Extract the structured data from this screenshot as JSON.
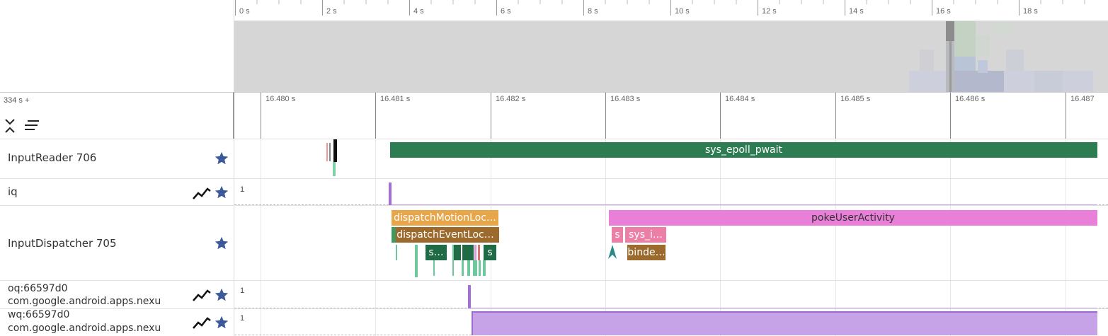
{
  "overview": {
    "ticks": [
      "0 s",
      "2 s",
      "4 s",
      "6 s",
      "8 s",
      "10 s",
      "12 s",
      "14 s",
      "16 s",
      "18 s"
    ]
  },
  "detail": {
    "offset_label": "334 s +",
    "ticks": [
      "16.480 s",
      "16.481 s",
      "16.482 s",
      "16.483 s",
      "16.484 s",
      "16.485 s",
      "16.486 s",
      "16.487"
    ]
  },
  "tracks": {
    "input_reader": {
      "name": "InputReader 706",
      "slice": "sys_epoll_pwait"
    },
    "iq": {
      "name": "iq",
      "scale": "1"
    },
    "input_dispatcher": {
      "name": "InputDispatcher 705",
      "slices": {
        "dispatch_motion": "dispatchMotionLoc…",
        "dispatch_event": "dispatchEventLoc…",
        "s_small": "s…",
        "s_right": "s",
        "poke": "pokeUserActivity",
        "s_pink": "s",
        "sys_i": "sys_i…",
        "binder": "binde…"
      }
    },
    "oq": {
      "name_line1": "oq:66597d0",
      "name_line2": "com.google.android.apps.nexu",
      "scale": "1"
    },
    "wq": {
      "name_line1": "wq:66597d0",
      "name_line2": "com.google.android.apps.nexu",
      "scale": "1"
    }
  },
  "colors": {
    "green": "#2e7d52",
    "orange": "#e8a64a",
    "brown": "#9b6a2c",
    "dark_green": "#1f6b45",
    "pink": "#ea7fd9",
    "light_pink": "#ec7fa6",
    "purple": "#b796db",
    "star": "#3a5a9a"
  },
  "icons": {
    "collapse": "collapse-all-icon",
    "filter": "filter-lines-icon",
    "star": "star-icon",
    "chart": "trend-chart-icon"
  }
}
